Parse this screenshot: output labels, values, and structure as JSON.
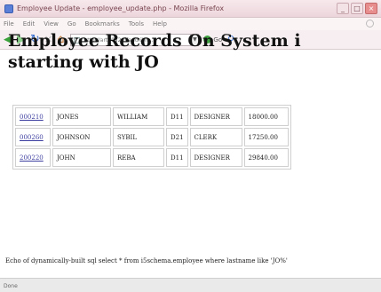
{
  "window": {
    "title": "Employee Update - employee_update.php - Mozilla Firefox",
    "controls": [
      "_",
      "□",
      "×"
    ]
  },
  "menu": [
    "File",
    "Edit",
    "View",
    "Go",
    "Bookmarks",
    "Tools",
    "Help"
  ],
  "toolbar": {
    "url": "http://art20a2/dfand.ibm...",
    "go_label": "Go",
    "icons": [
      "back-icon",
      "forward-icon",
      "reload-icon",
      "stop-icon",
      "home-icon"
    ]
  },
  "page": {
    "heading": "Employee Records On System i starting with JO",
    "records": [
      {
        "id": "000210",
        "last": "JONES",
        "first": "WILLIAM",
        "dept": "D11",
        "job": "DESIGNER",
        "salary": "18000.00"
      },
      {
        "id": "000260",
        "last": "JOHNSON",
        "first": "SYBIL",
        "dept": "D21",
        "job": "CLERK",
        "salary": "17250.00"
      },
      {
        "id": "200220",
        "last": "JOHN",
        "first": "REBA",
        "dept": "D11",
        "job": "DESIGNER",
        "salary": "29840.00"
      }
    ],
    "echo": "Echo of dynamically-built sql select * from i5schema.employee where lastname like 'JO%'"
  },
  "status": "Done"
}
